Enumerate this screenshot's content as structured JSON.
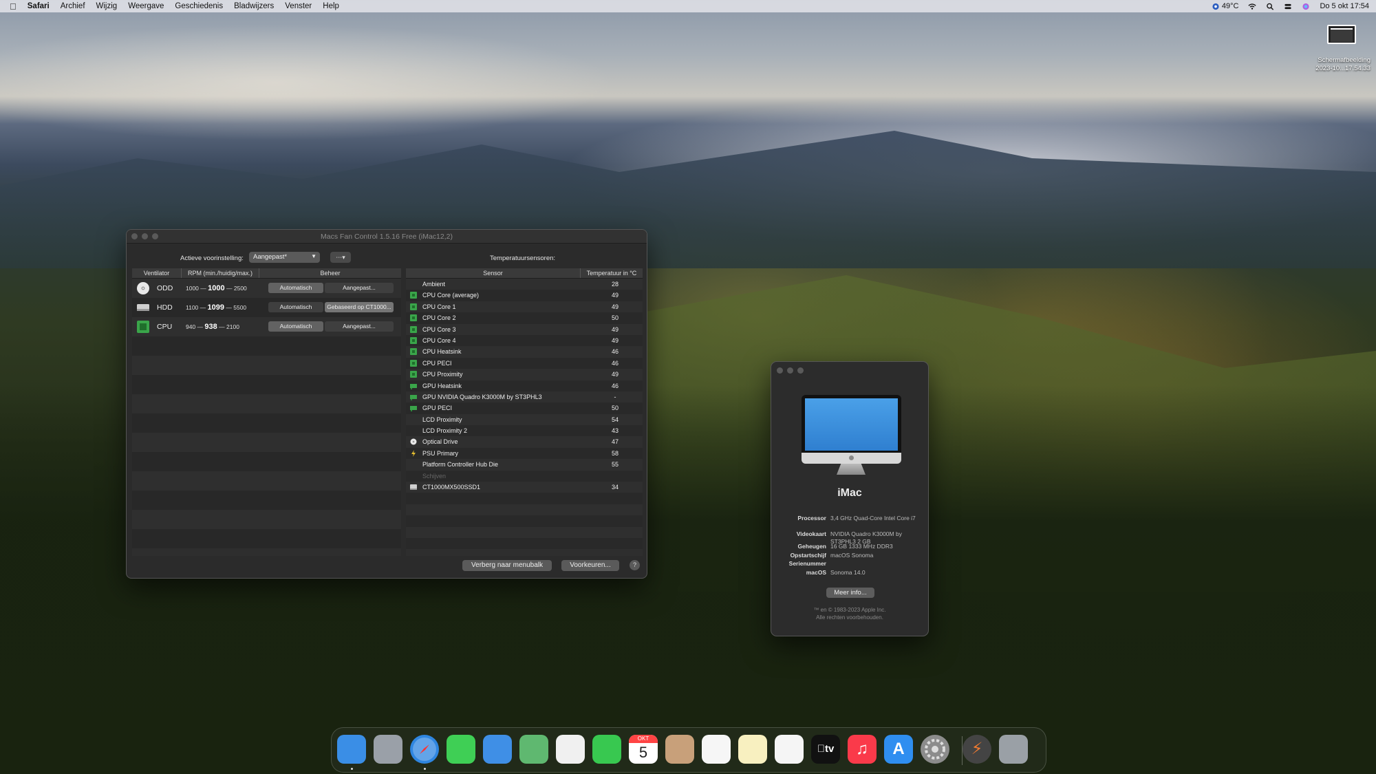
{
  "menubar": {
    "app": "Safari",
    "menus": [
      "Archief",
      "Wijzig",
      "Weergave",
      "Geschiedenis",
      "Bladwijzers",
      "Venster",
      "Help"
    ],
    "temperature": "49°C",
    "datetime": "Do 5 okt  17:54"
  },
  "screenshot_thumb": {
    "line1": "Schermafbeelding",
    "line2": "2023-10...17.54.33"
  },
  "fan_window": {
    "title": "Macs Fan Control 1.5.16 Free (iMac12,2)",
    "preset_label": "Actieve voorinstelling:",
    "preset_value": "Aangepast*",
    "temp_heading": "Temperatuursensoren:",
    "fan_headers": [
      "Ventilator",
      "RPM (min./huidig/max.)",
      "Beheer"
    ],
    "fans": [
      {
        "name": "ODD",
        "min": "1000",
        "current": "1000",
        "max": "2500",
        "auto": "Automatisch",
        "custom": "Aangepast...",
        "icon": "optical-drive-icon"
      },
      {
        "name": "HDD",
        "min": "1100",
        "current": "1099",
        "max": "5500",
        "auto": "Automatisch",
        "custom": "Gebaseerd op CT1000...",
        "icon": "hard-drive-icon"
      },
      {
        "name": "CPU",
        "min": "940",
        "current": "938",
        "max": "2100",
        "auto": "Automatisch",
        "custom": "Aangepast...",
        "icon": "cpu-chip-icon"
      }
    ],
    "sensor_headers": [
      "Sensor",
      "Temperatuur in °C"
    ],
    "sensors": [
      {
        "name": "Ambient",
        "value": "28",
        "icon": ""
      },
      {
        "name": "CPU Core (average)",
        "value": "49",
        "icon": "cpu"
      },
      {
        "name": "CPU Core 1",
        "value": "49",
        "icon": "cpu"
      },
      {
        "name": "CPU Core 2",
        "value": "50",
        "icon": "cpu"
      },
      {
        "name": "CPU Core 3",
        "value": "49",
        "icon": "cpu"
      },
      {
        "name": "CPU Core 4",
        "value": "49",
        "icon": "cpu"
      },
      {
        "name": "CPU Heatsink",
        "value": "46",
        "icon": "cpu"
      },
      {
        "name": "CPU PECI",
        "value": "46",
        "icon": "cpu"
      },
      {
        "name": "CPU Proximity",
        "value": "49",
        "icon": "cpu"
      },
      {
        "name": "GPU Heatsink",
        "value": "46",
        "icon": "gpu"
      },
      {
        "name": "GPU NVIDIA Quadro K3000M by ST3PHL3",
        "value": "-",
        "icon": "gpu"
      },
      {
        "name": "GPU PECI",
        "value": "50",
        "icon": "gpu"
      },
      {
        "name": "LCD Proximity",
        "value": "54",
        "icon": ""
      },
      {
        "name": "LCD Proximity 2",
        "value": "43",
        "icon": ""
      },
      {
        "name": "Optical Drive",
        "value": "47",
        "icon": "disc"
      },
      {
        "name": "PSU Primary",
        "value": "58",
        "icon": "power"
      },
      {
        "name": "Platform Controller Hub Die",
        "value": "55",
        "icon": ""
      },
      {
        "name": "Schijven",
        "value": "",
        "icon": "",
        "muted": true
      },
      {
        "name": "CT1000MX500SSD1",
        "value": "34",
        "icon": "drive"
      }
    ],
    "hide_button": "Verberg naar menubalk",
    "prefs_button": "Voorkeuren...",
    "help_button": "?"
  },
  "about": {
    "model": "iMac",
    "specs": [
      {
        "key": "Processor",
        "value": "3,4 GHz Quad-Core Intel Core i7"
      },
      {
        "key": "Videokaart",
        "value": "NVIDIA Quadro K3000M by ST3PHL3 2 GB"
      },
      {
        "key": "Geheugen",
        "value": "16 GB 1333 MHz DDR3"
      },
      {
        "key": "Opstartschijf",
        "value": "macOS Sonoma"
      },
      {
        "key": "Serienummer",
        "value": ""
      },
      {
        "key": "macOS",
        "value": "Sonoma 14.0"
      }
    ],
    "more_button": "Meer info...",
    "copyright_1": "™ en © 1983-2023 Apple Inc.",
    "copyright_2": "Alle rechten voorbehouden."
  },
  "dock": {
    "calendar_month": "OKT",
    "calendar_day": "5",
    "tv_label": "tv",
    "items": [
      {
        "name": "finder",
        "color": "#3a8ee6"
      },
      {
        "name": "launchpad",
        "color": "#9aa0a8"
      },
      {
        "name": "safari",
        "color": "#2f86e0"
      },
      {
        "name": "messages",
        "color": "#3fcf55"
      },
      {
        "name": "mail",
        "color": "#3f8fe6"
      },
      {
        "name": "maps",
        "color": "#5fb870"
      },
      {
        "name": "photos",
        "color": "#f0f0f0"
      },
      {
        "name": "facetime",
        "color": "#38c850"
      },
      {
        "name": "calendar",
        "color": "#ffffff"
      },
      {
        "name": "contacts",
        "color": "#c8a07a"
      },
      {
        "name": "reminders",
        "color": "#f6f6f6"
      },
      {
        "name": "notes",
        "color": "#f8f0c0"
      },
      {
        "name": "freeform",
        "color": "#f5f5f5"
      },
      {
        "name": "apple-tv",
        "color": "#111111"
      },
      {
        "name": "music",
        "color": "#fa3a4a"
      },
      {
        "name": "app-store",
        "color": "#2f8ef0"
      },
      {
        "name": "system-settings",
        "color": "#8c8c8c"
      },
      {
        "name": "macs-fan-control",
        "color": "#444444"
      },
      {
        "name": "trash",
        "color": "#9aa0a6"
      }
    ]
  }
}
